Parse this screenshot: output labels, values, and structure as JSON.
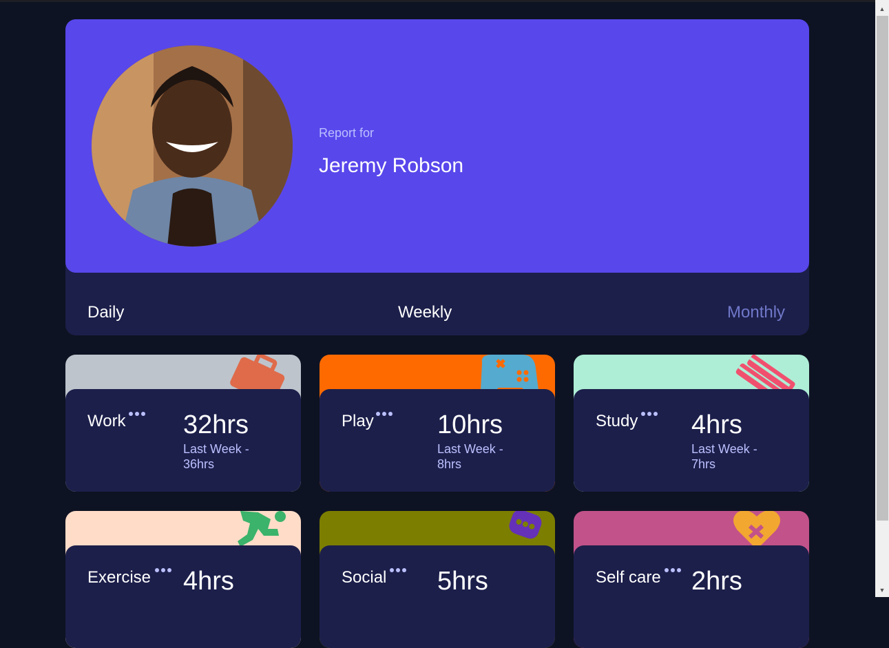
{
  "profile": {
    "report_for_label": "Report for",
    "name": "Jeremy Robson"
  },
  "tabs": [
    {
      "label": "Daily",
      "active": false
    },
    {
      "label": "Weekly",
      "active": true
    },
    {
      "label": "Monthly",
      "active": false
    }
  ],
  "activities": [
    {
      "title": "Work",
      "current": "32hrs",
      "previous": "Last Week - 36hrs",
      "color": "#bdc4cc",
      "icon": "briefcase-icon"
    },
    {
      "title": "Play",
      "current": "10hrs",
      "previous": "Last Week - 8hrs",
      "color": "#ff6a00",
      "icon": "gamepad-icon"
    },
    {
      "title": "Study",
      "current": "4hrs",
      "previous": "Last Week - 7hrs",
      "color": "#aeeed6",
      "icon": "books-icon"
    },
    {
      "title": "Exercise",
      "current": "4hrs",
      "previous": "",
      "color": "#ffdcc8",
      "icon": "running-icon"
    },
    {
      "title": "Social",
      "current": "5hrs",
      "previous": "",
      "color": "#7c7e00",
      "icon": "chat-icon"
    },
    {
      "title": "Self care",
      "current": "2hrs",
      "previous": "",
      "color": "#c2528a",
      "icon": "heart-icon"
    }
  ]
}
